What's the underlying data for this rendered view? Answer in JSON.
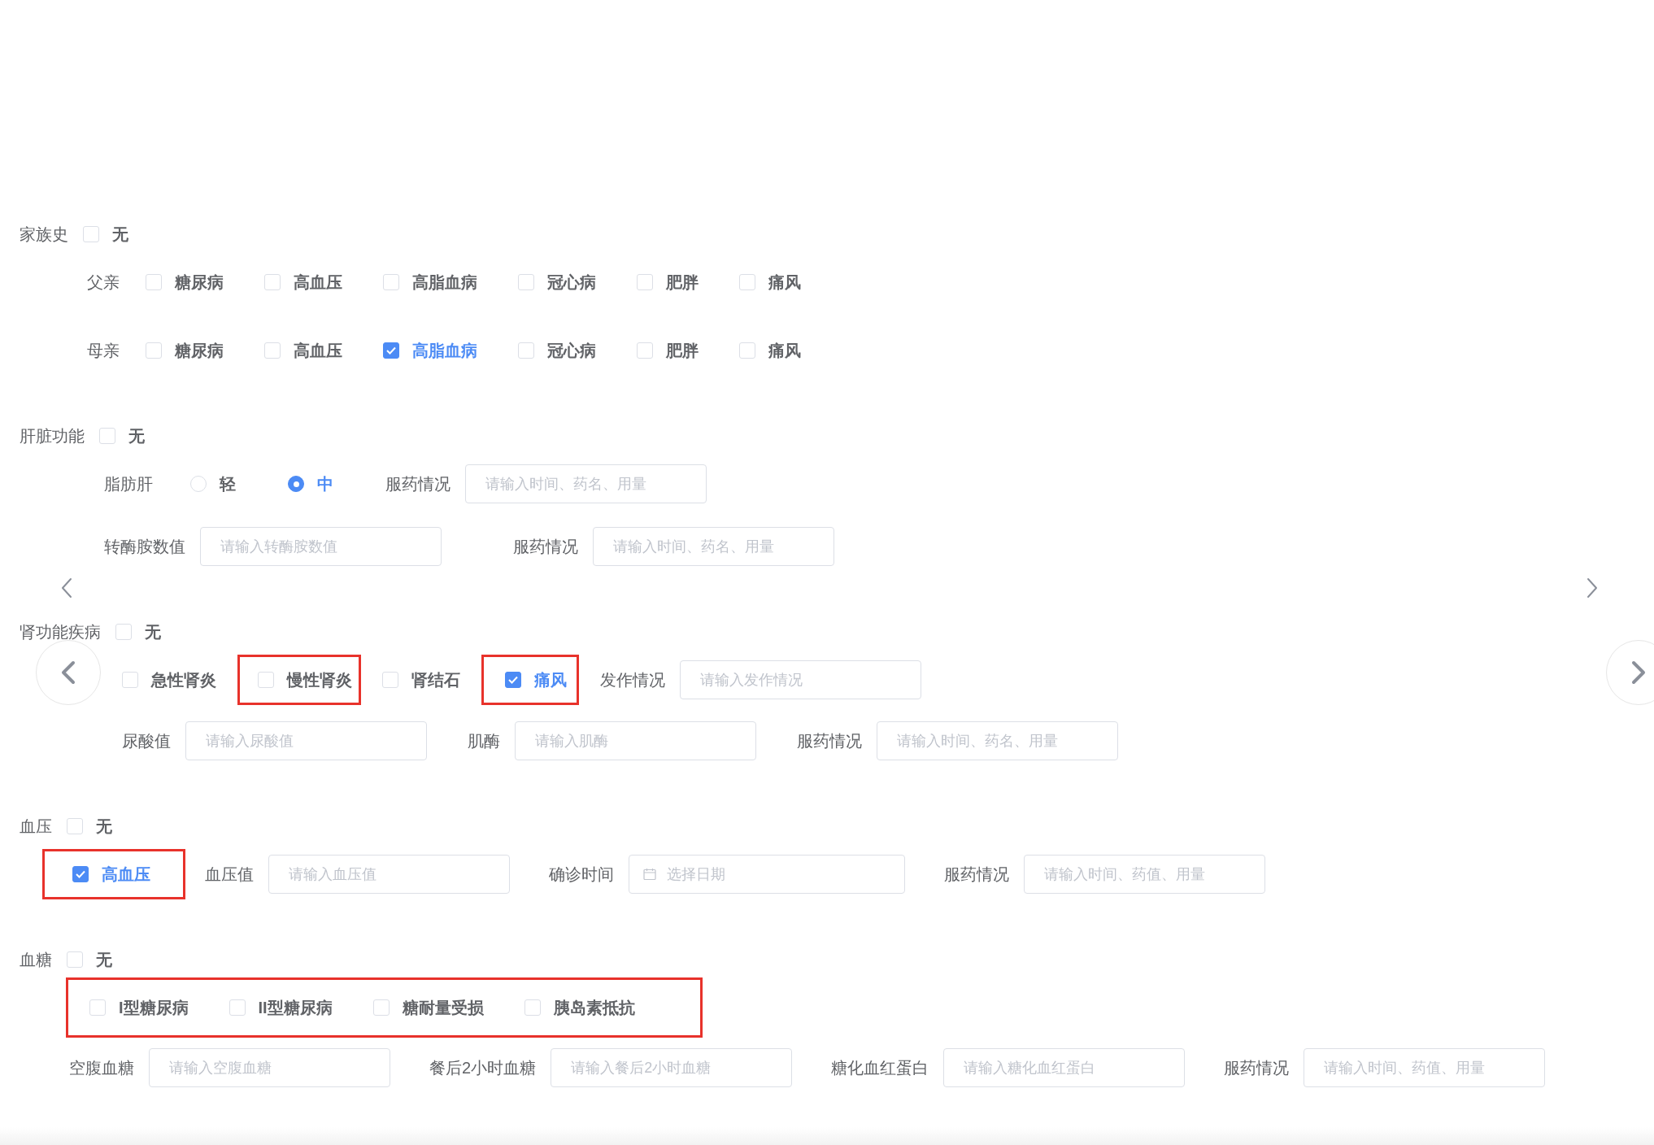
{
  "sections": [
    {
      "kind": "family",
      "title": "家族史",
      "none": {
        "label": "无",
        "checked": false
      },
      "rows": [
        {
          "items": [
            {
              "kind": "text",
              "label": "父亲"
            },
            {
              "kind": "checkbox",
              "label": "糖尿病",
              "checked": false
            },
            {
              "kind": "checkbox",
              "label": "高血压",
              "checked": false
            },
            {
              "kind": "checkbox",
              "label": "高脂血病",
              "checked": false
            },
            {
              "kind": "checkbox",
              "label": "冠心病",
              "checked": false
            },
            {
              "kind": "checkbox",
              "label": "肥胖",
              "checked": false
            },
            {
              "kind": "checkbox",
              "label": "痛风",
              "checked": false
            }
          ]
        },
        {
          "items": [
            {
              "kind": "text",
              "label": "母亲"
            },
            {
              "kind": "checkbox",
              "label": "糖尿病",
              "checked": false
            },
            {
              "kind": "checkbox",
              "label": "高血压",
              "checked": false
            },
            {
              "kind": "checkbox",
              "label": "高脂血病",
              "checked": true
            },
            {
              "kind": "checkbox",
              "label": "冠心病",
              "checked": false
            },
            {
              "kind": "checkbox",
              "label": "肥胖",
              "checked": false
            },
            {
              "kind": "checkbox",
              "label": "痛风",
              "checked": false
            }
          ]
        }
      ]
    },
    {
      "kind": "liver",
      "title": "肝脏功能",
      "none": {
        "label": "无",
        "checked": false
      },
      "rows": [
        {
          "items": [
            {
              "kind": "text",
              "label": "脂肪肝"
            },
            {
              "kind": "radio",
              "label": "轻",
              "selected": false
            },
            {
              "kind": "radio",
              "label": "中",
              "selected": true
            },
            {
              "kind": "field",
              "label": "服药情况",
              "placeholder": "请输入时间、药名、用量"
            }
          ]
        },
        {
          "items": [
            {
              "kind": "field",
              "label": "转酶胺数值",
              "placeholder": "请输入转酶胺数值"
            },
            {
              "kind": "field",
              "label": "服药情况",
              "placeholder": "请输入时间、药名、用量"
            }
          ]
        }
      ]
    },
    {
      "kind": "kidney",
      "title": "肾功能疾病",
      "none": {
        "label": "无",
        "checked": false
      },
      "rows": [
        {
          "items": [
            {
              "kind": "checkbox",
              "label": "急性肾炎",
              "checked": false
            },
            {
              "kind": "checkbox",
              "label": "慢性肾炎",
              "checked": false,
              "highlighted": true
            },
            {
              "kind": "checkbox",
              "label": "肾结石",
              "checked": false
            },
            {
              "kind": "checkbox",
              "label": "痛风",
              "checked": true,
              "highlighted": true
            },
            {
              "kind": "field",
              "label": "发作情况",
              "placeholder": "请输入发作情况"
            }
          ]
        },
        {
          "items": [
            {
              "kind": "field",
              "label": "尿酸值",
              "placeholder": "请输入尿酸值"
            },
            {
              "kind": "field",
              "label": "肌酶",
              "placeholder": "请输入肌酶"
            },
            {
              "kind": "field",
              "label": "服药情况",
              "placeholder": "请输入时间、药名、用量"
            }
          ]
        }
      ]
    },
    {
      "kind": "pressure",
      "title": "血压",
      "none": {
        "label": "无",
        "checked": false
      },
      "rows": [
        {
          "items": [
            {
              "kind": "checkbox",
              "label": "高血压",
              "checked": true,
              "highlighted": true
            },
            {
              "kind": "field",
              "label": "血压值",
              "placeholder": "请输入血压值"
            },
            {
              "kind": "date",
              "label": "确诊时间",
              "placeholder": "选择日期"
            },
            {
              "kind": "field",
              "label": "服药情况",
              "placeholder": "请输入时间、药值、用量"
            }
          ]
        }
      ]
    },
    {
      "kind": "sugar",
      "title": "血糖",
      "none": {
        "label": "无",
        "checked": false
      },
      "rows": [
        {
          "items": [
            {
              "kind": "group",
              "highlighted": true,
              "items": [
                {
                  "kind": "checkbox",
                  "label": "I型糖尿病",
                  "checked": false
                },
                {
                  "kind": "checkbox",
                  "label": "II型糖尿病",
                  "checked": false
                },
                {
                  "kind": "checkbox",
                  "label": "糖耐量受损",
                  "checked": false
                },
                {
                  "kind": "checkbox",
                  "label": "胰岛素抵抗",
                  "checked": false
                }
              ]
            }
          ]
        },
        {
          "items": [
            {
              "kind": "field",
              "label": "空腹血糖",
              "placeholder": "请输入空腹血糖"
            },
            {
              "kind": "field",
              "label": "餐后2小时血糖",
              "placeholder": "请输入餐后2小时血糖"
            },
            {
              "kind": "field",
              "label": "糖化血红蛋白",
              "placeholder": "请输入糖化血红蛋白"
            },
            {
              "kind": "field",
              "label": "服药情况",
              "placeholder": "请输入时间、药值、用量"
            }
          ]
        }
      ]
    }
  ]
}
